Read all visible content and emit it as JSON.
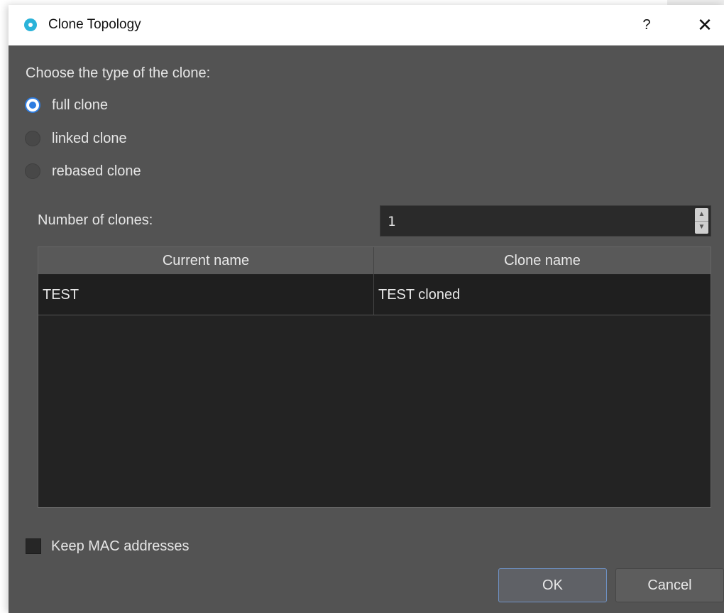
{
  "window": {
    "title": "Clone Topology",
    "help_glyph": "?",
    "close_glyph": "✕"
  },
  "clone_type": {
    "label": "Choose the type of the clone:",
    "options": [
      {
        "label": "full clone",
        "checked": true
      },
      {
        "label": "linked clone",
        "checked": false
      },
      {
        "label": "rebased clone",
        "checked": false
      }
    ]
  },
  "clones": {
    "label": "Number of clones:",
    "value": "1"
  },
  "table": {
    "headers": [
      "Current name",
      "Clone name"
    ],
    "rows": [
      [
        "TEST",
        "TEST cloned"
      ]
    ]
  },
  "keep_mac": {
    "label": "Keep MAC addresses",
    "checked": false
  },
  "buttons": {
    "ok": "OK",
    "cancel": "Cancel"
  },
  "colors": {
    "dialog_bg": "#535353",
    "accent": "#2e7de1",
    "title_icon": "#2bb3d9"
  }
}
